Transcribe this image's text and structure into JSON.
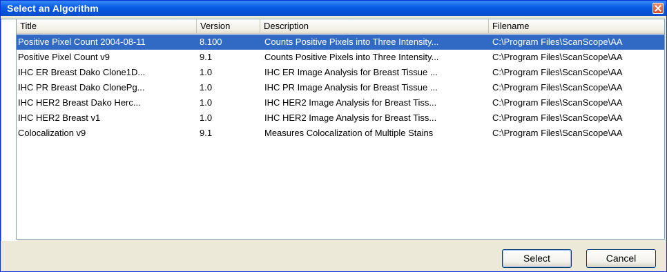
{
  "dialog": {
    "title": "Select an Algorithm"
  },
  "columns": [
    {
      "label": "Title"
    },
    {
      "label": "Version"
    },
    {
      "label": "Description"
    },
    {
      "label": "Filename"
    }
  ],
  "rows": [
    {
      "title": "Positive Pixel Count 2004-08-11",
      "version": "8.100",
      "description": "Counts Positive Pixels into Three Intensity...",
      "filename": "C:\\Program Files\\ScanScope\\AA",
      "selected": true
    },
    {
      "title": "Positive Pixel Count v9",
      "version": "9.1",
      "description": "Counts Positive Pixels into Three Intensity...",
      "filename": "C:\\Program Files\\ScanScope\\AA"
    },
    {
      "title": "IHC ER Breast Dako Clone1D...",
      "version": "1.0",
      "description": "IHC ER Image Analysis for Breast Tissue ...",
      "filename": "C:\\Program Files\\ScanScope\\AA"
    },
    {
      "title": "IHC PR Breast Dako ClonePg...",
      "version": "1.0",
      "description": "IHC PR Image Analysis for Breast Tissue ...",
      "filename": "C:\\Program Files\\ScanScope\\AA"
    },
    {
      "title": "IHC HER2 Breast Dako Herc...",
      "version": "1.0",
      "description": "IHC HER2 Image Analysis for Breast Tiss...",
      "filename": "C:\\Program Files\\ScanScope\\AA"
    },
    {
      "title": "IHC HER2 Breast v1",
      "version": "1.0",
      "description": "IHC HER2 Image Analysis for Breast Tiss...",
      "filename": "C:\\Program Files\\ScanScope\\AA"
    },
    {
      "title": "Colocalization v9",
      "version": "9.1",
      "description": "Measures Colocalization of Multiple Stains",
      "filename": "C:\\Program Files\\ScanScope\\AA"
    }
  ],
  "buttons": {
    "select": "Select",
    "cancel": "Cancel"
  },
  "icons": {
    "row_icon": "magnifier-algorithm-icon",
    "close": "close-icon"
  },
  "colors": {
    "titlebar": "#0A5FE6",
    "selection": "#316AC5"
  }
}
